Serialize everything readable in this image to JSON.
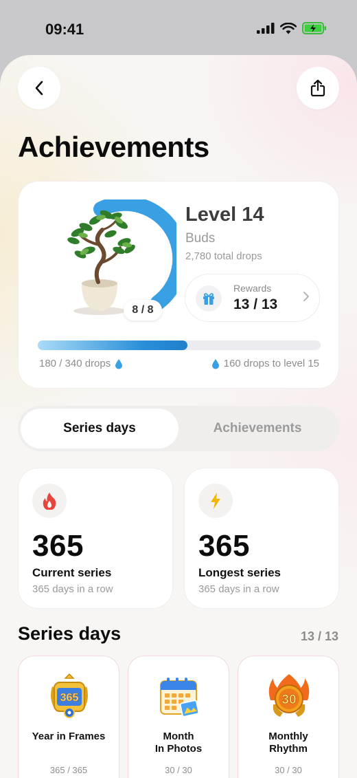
{
  "status_bar": {
    "time": "09:41"
  },
  "header": {
    "title": "Achievements"
  },
  "level_card": {
    "level": "Level 14",
    "stage": "Buds",
    "total": "2,780 total drops",
    "ring_badge": "8 / 8",
    "ring_progress": 1.0,
    "rewards_label": "Rewards",
    "rewards_value": "13 / 13",
    "progress_left": "180 / 340 drops",
    "progress_right": "160 drops to level 15",
    "progress_fraction": 0.53,
    "accent": "#2a8fd8"
  },
  "segmented": {
    "active": "Series days",
    "inactive": "Achievements"
  },
  "stats": [
    {
      "value": "365",
      "label": "Current series",
      "sub": "365 days in a row",
      "icon": "flame-icon"
    },
    {
      "value": "365",
      "label": "Longest series",
      "sub": "365 days in a row",
      "icon": "lightning-icon"
    }
  ],
  "series_section": {
    "title": "Series days",
    "count": "13 / 13",
    "badges": [
      {
        "name": "Year in Frames",
        "progress": "365 / 365",
        "art_text": "365"
      },
      {
        "name_line1": "Month",
        "name_line2": "In Photos",
        "progress": "30 / 30"
      },
      {
        "name_line1": "Monthly",
        "name_line2": "Rhythm",
        "progress": "30 / 30",
        "art_text": "30"
      }
    ]
  }
}
